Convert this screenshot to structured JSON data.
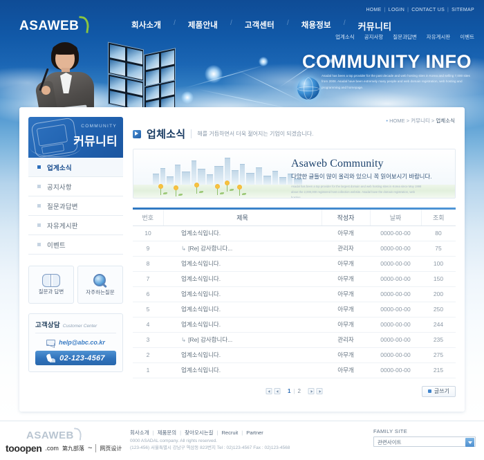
{
  "brand": {
    "logo_text": "ASAWEB",
    "footer_logo_text": "ASAWEB"
  },
  "util_nav": {
    "items": [
      "HOME",
      "LOGIN",
      "CONTACT US",
      "SITEMAP"
    ],
    "separator": "|"
  },
  "main_nav": {
    "separator": "/",
    "items": [
      {
        "label": "회사소개"
      },
      {
        "label": "제품안내"
      },
      {
        "label": "고객센터"
      },
      {
        "label": "채용정보"
      },
      {
        "label": "커뮤니티"
      }
    ],
    "sub_items": [
      "업계소식",
      "공지사항",
      "질문과답변",
      "자유게시판",
      "이벤트"
    ]
  },
  "hero": {
    "title": "COMMUNITY INFO",
    "subtext": "Asadal has been a top provider for the past decade and web hosting sites in Korea and selling 7,000 sites from 2008. Asadal have been extremely many people and web domain registration, web hosting and programming and homepage."
  },
  "sidebar": {
    "header": {
      "english": "COMMUNITY",
      "korean": "커뮤니티"
    },
    "items": [
      {
        "label": "업계소식",
        "active": true
      },
      {
        "label": "공지사항",
        "active": false
      },
      {
        "label": "질문과답변",
        "active": false
      },
      {
        "label": "자유게시판",
        "active": false
      },
      {
        "label": "이벤트",
        "active": false
      }
    ],
    "quick": [
      {
        "label": "질문과 답변",
        "icon": "book-icon"
      },
      {
        "label": "자주하는질문",
        "icon": "magnifier-icon"
      }
    ],
    "customer_center": {
      "title_ko": "고객상담",
      "title_en": "Customer Center",
      "email": "help@abc.co.kr",
      "phone": "02-123-4567"
    }
  },
  "breadcrumb": {
    "dot": "•",
    "home": "HOME",
    "arrow": ">",
    "section": "커뮤니티",
    "current": "업체소식"
  },
  "page_title": {
    "text": "업체소식",
    "description": "해를 거듭하면서 더욱 젊어지는 기업이 되겠습니다."
  },
  "banner": {
    "heading": "Asaweb Community",
    "paragraph": "다양한 글들이 많이 올리와 있으니 꼭 읽어보시기 바랍니다.",
    "small_text": "Asadal has been a top provider for the largest domain and web hosting sites in Korea since May 1998 about the 2,000,000 registered host collection website. Asadal have the domain registration, web hosting."
  },
  "table": {
    "headers": [
      "번호",
      "제목",
      "작성자",
      "날짜",
      "조회"
    ],
    "rows": [
      {
        "no": "10",
        "title": "업계소식입니다.",
        "reply": false,
        "author": "아무개",
        "date": "0000-00-00",
        "hits": "80"
      },
      {
        "no": "9",
        "title": "[Re] 감사합니다...",
        "reply": true,
        "author": "관리자",
        "date": "0000-00-00",
        "hits": "75"
      },
      {
        "no": "8",
        "title": "업계소식입니다.",
        "reply": false,
        "author": "아무개",
        "date": "0000-00-00",
        "hits": "100"
      },
      {
        "no": "7",
        "title": "업계소식입니다.",
        "reply": false,
        "author": "아무개",
        "date": "0000-00-00",
        "hits": "150"
      },
      {
        "no": "6",
        "title": "업계소식입니다.",
        "reply": false,
        "author": "아무개",
        "date": "0000-00-00",
        "hits": "200"
      },
      {
        "no": "5",
        "title": "업계소식입니다.",
        "reply": false,
        "author": "아무개",
        "date": "0000-00-00",
        "hits": "250"
      },
      {
        "no": "4",
        "title": "업계소식입니다.",
        "reply": false,
        "author": "아무개",
        "date": "0000-00-00",
        "hits": "244"
      },
      {
        "no": "3",
        "title": "[Re] 감사합니다...",
        "reply": true,
        "author": "관리자",
        "date": "0000-00-00",
        "hits": "235"
      },
      {
        "no": "2",
        "title": "업계소식입니다.",
        "reply": false,
        "author": "아무개",
        "date": "0000-00-00",
        "hits": "275"
      },
      {
        "no": "1",
        "title": "업계소식입니다.",
        "reply": false,
        "author": "아무개",
        "date": "0000-00-00",
        "hits": "215"
      }
    ],
    "reply_arrow": "↳"
  },
  "pagination": {
    "pages": [
      "1",
      "2"
    ],
    "current": "1",
    "divider": "|"
  },
  "write_button": {
    "label": "글쓰기"
  },
  "footer": {
    "links": [
      "회사소개",
      "제품문의",
      "찾아오시는길",
      "Recruit",
      "Partner"
    ],
    "bar": "|",
    "copyright_line1": "0000 ASADAL company. All rights reserved.",
    "copyright_line2": "(123-456) 서울특별시 강남구 역삼동 823번지 Tel : 02)123-4567 Fax : 02)123-4568",
    "family_site_label": "FAMILY SITE",
    "family_site_selected": "관련사이트"
  },
  "watermark": {
    "main": "tooopen",
    "com": ".com",
    "cn": "第九部落",
    "tail": "~",
    "suffix": "网页设计"
  },
  "colors": {
    "brand_blue": "#1f5fa8",
    "accent_blue": "#2f78c2",
    "logo_green": "#8cc63f",
    "link_blue": "#3a7cc4"
  }
}
